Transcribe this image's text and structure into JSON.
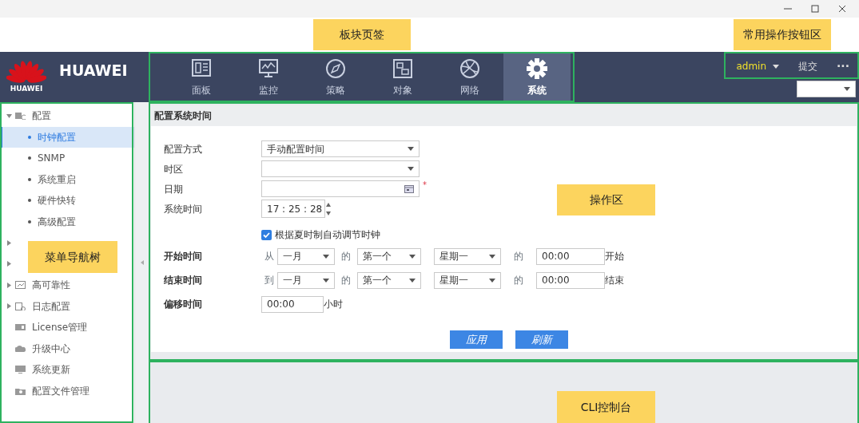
{
  "callouts": [
    {
      "label": "板块页签"
    },
    {
      "label": "常用操作按钮区"
    },
    {
      "label": "菜单导航树"
    },
    {
      "label": "操作区"
    },
    {
      "label": "CLI控制台"
    }
  ],
  "header": {
    "logo_caption": "HUAWEI",
    "brand": "HUAWEI",
    "user": "admin",
    "submit": "提交",
    "more": "···",
    "tabs": [
      {
        "label": "面板",
        "selected": false
      },
      {
        "label": "监控",
        "selected": false
      },
      {
        "label": "策略",
        "selected": false
      },
      {
        "label": "对象",
        "selected": false
      },
      {
        "label": "网络",
        "selected": false
      },
      {
        "label": "系统",
        "selected": true
      }
    ]
  },
  "sidebar": {
    "items": [
      {
        "label": "配置",
        "expanded": true,
        "children": [
          {
            "label": "时钟配置",
            "selected": true
          },
          {
            "label": "SNMP",
            "selected": false
          },
          {
            "label": "系统重启",
            "selected": false
          },
          {
            "label": "硬件快转",
            "selected": false
          },
          {
            "label": "高级配置",
            "selected": false
          }
        ]
      },
      {
        "expanded": false
      },
      {
        "expanded": false
      },
      {
        "label": "高可靠性",
        "expanded": false
      },
      {
        "label": "日志配置",
        "expanded": false
      },
      {
        "label": "License管理"
      },
      {
        "label": "升级中心"
      },
      {
        "label": "系统更新"
      },
      {
        "label": "配置文件管理"
      }
    ]
  },
  "panel": {
    "title": "配置系统时间",
    "fields": [
      {
        "kind": "select",
        "label": "配置方式",
        "value": "手动配置时间"
      },
      {
        "kind": "select",
        "label": "时区"
      },
      {
        "kind": "date",
        "label": "日期",
        "required_mark": "*"
      },
      {
        "kind": "time",
        "label": "系统时间",
        "value": "17 : 25 : 28"
      }
    ],
    "dst": {
      "label": "根据夏时制自动调节时钟",
      "checked": true
    },
    "dst_rows": [
      {
        "label": "开始时间",
        "prefix": "从",
        "month": "一月",
        "of_1": "的",
        "week": "第一个",
        "day": "星期一",
        "of_2": "的",
        "time": "00:00",
        "suffix": "开始"
      },
      {
        "label": "结束时间",
        "prefix": "到",
        "month": "一月",
        "of_1": "的",
        "week": "第一个",
        "day": "星期一",
        "of_2": "的",
        "time": "00:00",
        "suffix": "结束"
      }
    ],
    "offset": {
      "label": "偏移时间",
      "value": "00:00",
      "unit": "小时"
    },
    "buttons": [
      "应用",
      "刷新"
    ]
  }
}
